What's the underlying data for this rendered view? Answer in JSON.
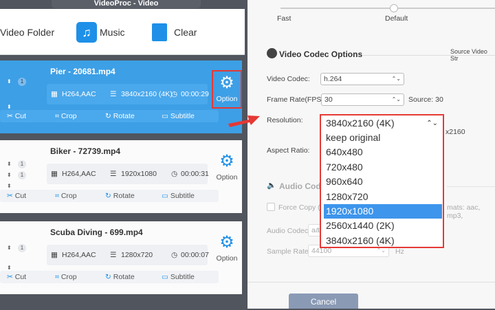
{
  "window": {
    "title": "VideoProc - Video"
  },
  "toolbar": {
    "video_folder": "Video Folder",
    "music": "Music",
    "clear": "Clear"
  },
  "files": [
    {
      "name": "Pier - 20681.mp4",
      "codec": "H264,AAC",
      "resolution": "3840x2160 (4K)",
      "duration": "00:00:29",
      "badges": [
        "1"
      ],
      "selected": true
    },
    {
      "name": "Biker - 72739.mp4",
      "codec": "H264,AAC",
      "resolution": "1920x1080",
      "duration": "00:00:31",
      "badges": [
        "1",
        "1"
      ],
      "selected": false
    },
    {
      "name": "Scuba Diving - 699.mp4",
      "codec": "H264,AAC",
      "resolution": "1280x720",
      "duration": "00:00:07",
      "badges": [
        "1"
      ],
      "selected": false
    }
  ],
  "item_actions": {
    "cut": "Cut",
    "crop": "Crop",
    "rotate": "Rotate",
    "subtitle": "Subtitle",
    "option": "Option",
    "codec_icon_text": "codec"
  },
  "quality": {
    "fast": "Fast",
    "default": "Default"
  },
  "video_codec": {
    "heading": "Video Codec Options",
    "source_stream": "Source Video Str",
    "codec_label": "Video Codec:",
    "codec_value": "h.264",
    "fps_label": "Frame Rate(FPS):",
    "fps_value": "30",
    "fps_source": "Source: 30",
    "resolution_label": "Resolution:",
    "resolution_source_partial": "x2160",
    "aspect_label": "Aspect Ratio:"
  },
  "resolution_dropdown": {
    "selected": "3840x2160 (4K)",
    "highlighted": "1920x1080",
    "options": [
      "keep original",
      "640x480",
      "720x480",
      "960x640",
      "1280x720",
      "1920x1080",
      "2560x1440 (2K)",
      "3840x2160 (4K)"
    ]
  },
  "audio_codec": {
    "heading": "Audio Codec",
    "force_copy": "Force Copy (P",
    "formats_partial": "mats: aac, mp3,",
    "codec_label": "Audio Codec:",
    "codec_value": "aac",
    "sample_label": "Sample Rate:",
    "sample_value": "44100",
    "sample_unit": "Hz"
  },
  "footer": {
    "cancel": "Cancel"
  },
  "colors": {
    "accent": "#3d9fe6",
    "highlight": "#e53935"
  }
}
